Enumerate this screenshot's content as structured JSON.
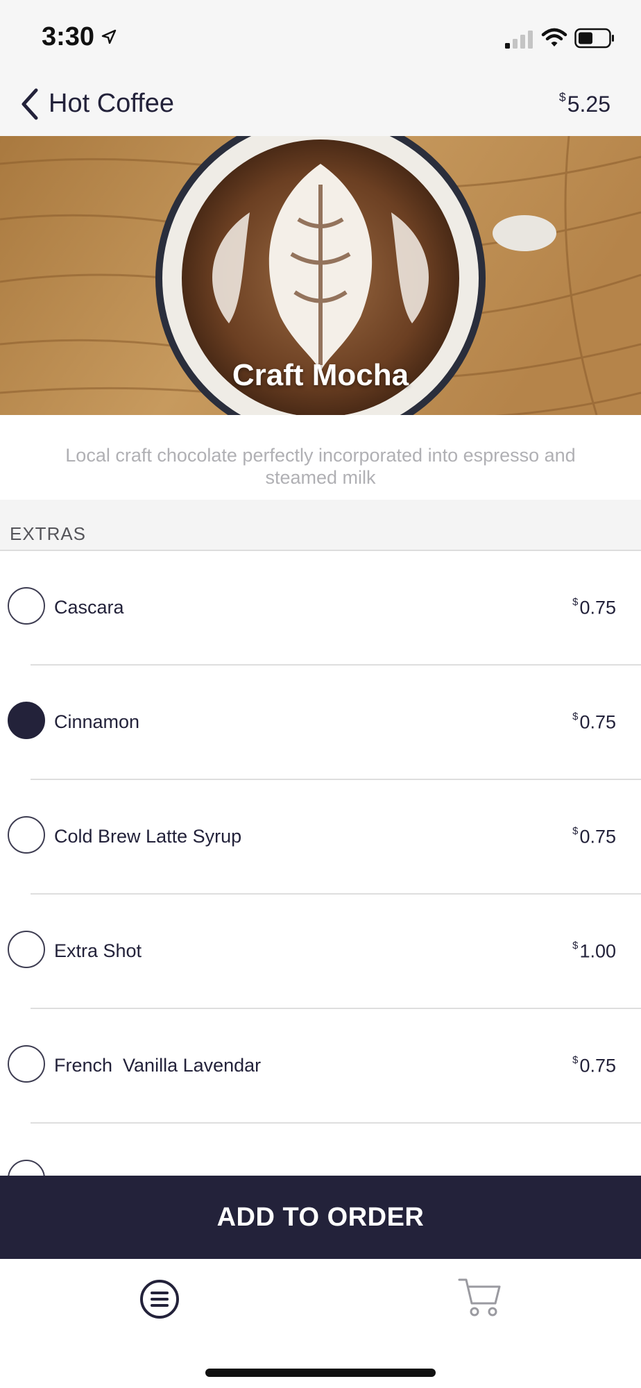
{
  "status_bar": {
    "time": "3:30",
    "icons": [
      "location-arrow-icon",
      "signal-icon",
      "wifi-icon",
      "battery-icon"
    ]
  },
  "nav": {
    "back_icon": "chevron-left-icon",
    "title": "Hot Coffee",
    "price_currency": "$",
    "price_amount": "5.25"
  },
  "product": {
    "name": "Craft Mocha",
    "description": "Local craft chocolate perfectly incorporated into espresso and steamed milk"
  },
  "extras": {
    "section_title": "EXTRAS",
    "items": [
      {
        "label": "Cascara",
        "currency": "$",
        "price": "0.75",
        "selected": false
      },
      {
        "label": "Cinnamon",
        "currency": "$",
        "price": "0.75",
        "selected": true
      },
      {
        "label": "Cold Brew Latte Syrup",
        "currency": "$",
        "price": "0.75",
        "selected": false
      },
      {
        "label": "Extra Shot",
        "currency": "$",
        "price": "1.00",
        "selected": false
      },
      {
        "label": "French  Vanilla Lavendar",
        "currency": "$",
        "price": "0.75",
        "selected": false
      }
    ]
  },
  "actions": {
    "add_to_order": "ADD TO ORDER"
  },
  "tab_bar": {
    "tabs": [
      "menu-icon",
      "cart-icon"
    ]
  },
  "colors": {
    "accent": "#23223a",
    "background_bar": "#f6f6f6",
    "muted_text": "#b0b0b4"
  }
}
